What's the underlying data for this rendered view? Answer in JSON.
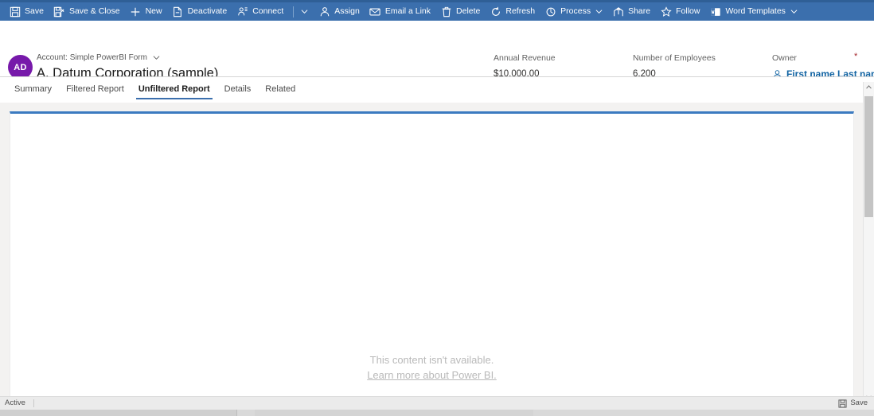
{
  "commandbar": {
    "items": [
      {
        "label": "Save",
        "icon": "save-icon",
        "caret": false
      },
      {
        "label": "Save & Close",
        "icon": "save-close-icon",
        "caret": false
      },
      {
        "label": "New",
        "icon": "plus-icon",
        "caret": false
      },
      {
        "label": "Deactivate",
        "icon": "deactivate-icon",
        "caret": false
      },
      {
        "label": "Connect",
        "icon": "connect-icon",
        "caret": false
      },
      {
        "label": "Assign",
        "icon": "assign-icon",
        "caret": false
      },
      {
        "label": "Email a Link",
        "icon": "email-link-icon",
        "caret": false
      },
      {
        "label": "Delete",
        "icon": "delete-icon",
        "caret": false
      },
      {
        "label": "Refresh",
        "icon": "refresh-icon",
        "caret": false
      },
      {
        "label": "Process",
        "icon": "process-icon",
        "caret": true
      },
      {
        "label": "Share",
        "icon": "share-icon",
        "caret": false
      },
      {
        "label": "Follow",
        "icon": "follow-star-icon",
        "caret": false
      },
      {
        "label": "Word Templates",
        "icon": "word-templates-icon",
        "caret": true
      }
    ],
    "overflow_caret_after": "Connect"
  },
  "record": {
    "avatar_initials": "AD",
    "form_name": "Account: Simple PowerBI Form",
    "title": "A. Datum Corporation (sample)",
    "fields": [
      {
        "label": "Annual Revenue",
        "value": "$10,000.00"
      },
      {
        "label": "Number of Employees",
        "value": "6,200"
      }
    ],
    "owner": {
      "label": "Owner",
      "required_marker": "*",
      "value": "First name Last name"
    }
  },
  "tabs": [
    {
      "label": "Summary",
      "active": false
    },
    {
      "label": "Filtered Report",
      "active": false
    },
    {
      "label": "Unfiltered Report",
      "active": true
    },
    {
      "label": "Details",
      "active": false
    },
    {
      "label": "Related",
      "active": false
    }
  ],
  "content": {
    "empty_message": "This content isn't available.",
    "empty_link": "Learn more about Power BI."
  },
  "statusbar": {
    "state": "Active",
    "save_label": "Save"
  },
  "colors": {
    "command_bar": "#3b6fad",
    "command_bar_top": "#2f5f96",
    "avatar": "#7719aa",
    "accent_link": "#1264a3",
    "tab_underline": "#3b6fad",
    "panel_top_border": "#3b7ac0",
    "required_star": "#a4262c",
    "empty_text": "#b9b9b9"
  }
}
